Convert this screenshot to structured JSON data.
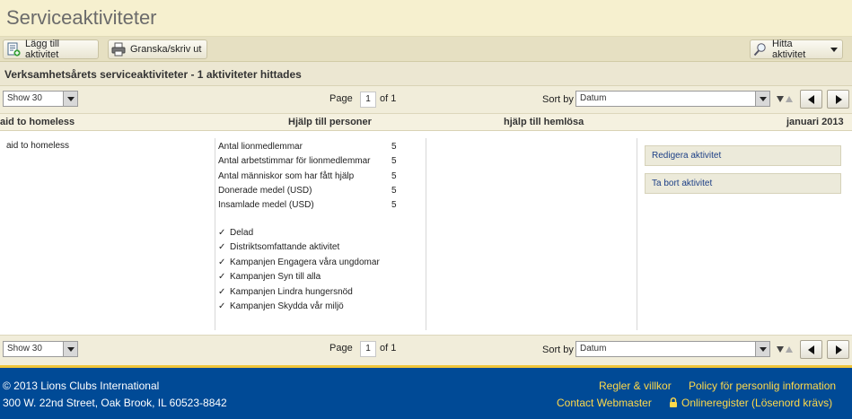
{
  "page": {
    "title": "Serviceaktiviteter"
  },
  "toolbar": {
    "add_label": "Lägg till aktivitet",
    "print_label": "Granska/skriv ut",
    "find_label": "Hitta aktivitet"
  },
  "results": {
    "heading": "Verksamhetsårets serviceaktiviteter - 1 aktiviteter hittades"
  },
  "pager": {
    "show_value": "Show 30",
    "page_label": "Page",
    "page_value": "1",
    "of_label": "of 1",
    "sort_label": "Sort by",
    "sort_value": "Datum"
  },
  "columns": {
    "name": "aid to homeless",
    "category": "Hjälp till personer",
    "subcategory": "hjälp till hemlösa",
    "date": "januari 2013"
  },
  "activity": {
    "description": "aid to homeless",
    "stats": [
      {
        "label": "Antal lionmedlemmar",
        "value": "5"
      },
      {
        "label": "Antal arbetstimmar för lionmedlemmar",
        "value": "5"
      },
      {
        "label": "Antal människor som har fått hjälp",
        "value": "5"
      },
      {
        "label": "Donerade medel (USD)",
        "value": "5"
      },
      {
        "label": "Insamlade medel (USD)",
        "value": "5"
      }
    ],
    "check_mark": "✓",
    "checks": [
      "Delad",
      "Distriktsomfattande aktivitet",
      "Kampanjen Engagera våra ungdomar",
      "Kampanjen Syn till alla",
      "Kampanjen Lindra hungersnöd",
      "Kampanjen Skydda vår miljö"
    ],
    "edit_label": "Redigera aktivitet",
    "delete_label": "Ta bort aktivitet"
  },
  "footer": {
    "copyright": "© 2013 Lions Clubs International",
    "address": "300 W. 22nd Street, Oak Brook, IL 60523-8842",
    "terms": "Regler & villkor",
    "privacy": "Policy för personlig information",
    "contact": "Contact Webmaster",
    "register": "Onlineregister (Lösenord krävs)"
  },
  "colors": {
    "title_bg": "#f6f0cf",
    "toolbar_bg": "#e6e0c2",
    "footer_bg": "#004a96",
    "footer_link": "#ffd94a",
    "accent_gold": "#f0c53a",
    "link_blue": "#1c3f86"
  }
}
